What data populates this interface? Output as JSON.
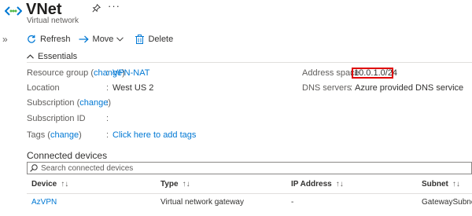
{
  "header": {
    "title": "VNet",
    "subtitle": "Virtual network",
    "more": "···"
  },
  "toolbar": {
    "refresh": "Refresh",
    "move": "Move",
    "delete": "Delete"
  },
  "essentials": {
    "label": "Essentials",
    "left": [
      {
        "key": "Resource group",
        "key_link": "change",
        "value": "VPN-NAT",
        "value_is_link": true
      },
      {
        "key": "Location",
        "value": "West US 2"
      },
      {
        "key": "Subscription",
        "key_link": "change",
        "value": ""
      },
      {
        "key": "Subscription ID",
        "value": ""
      },
      {
        "key": "Tags",
        "key_link": "change",
        "value": "Click here to add tags",
        "value_is_link": true
      }
    ],
    "right": [
      {
        "key": "Address space",
        "value": "10.0.1.0/24"
      },
      {
        "key": "DNS servers",
        "value": "Azure provided DNS service"
      }
    ]
  },
  "connected_devices": {
    "title": "Connected devices",
    "search_placeholder": "Search connected devices",
    "columns": [
      "Device",
      "Type",
      "IP Address",
      "Subnet"
    ],
    "rows": [
      {
        "device": "AzVPN",
        "type": "Virtual network gateway",
        "ip": "-",
        "subnet": "GatewaySubnet"
      }
    ]
  },
  "icons": {
    "resource": "vnet-icon",
    "pin": "pin-icon",
    "collapse": "expand-sidebar-icon",
    "refresh": "refresh-icon",
    "move": "arrow-right-icon",
    "delete": "trash-icon",
    "essentials": "chevron-up-icon",
    "search": "search-icon",
    "sort": "sort-icon"
  },
  "colors": {
    "link": "#0078d4",
    "highlight": "#e00000"
  }
}
